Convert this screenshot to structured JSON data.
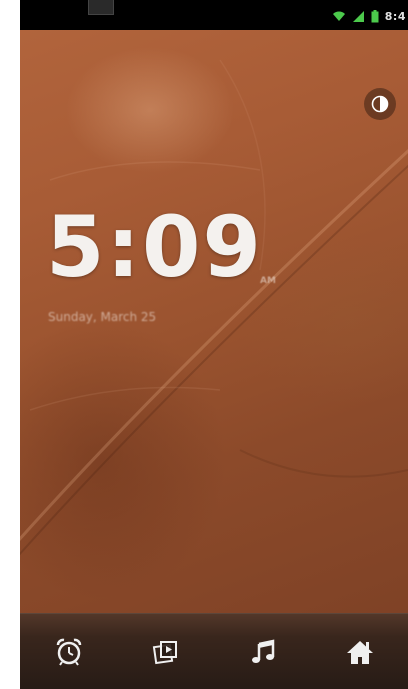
{
  "status_bar": {
    "time": "8:4",
    "icons": [
      "notification-app-icon",
      "wifi-icon",
      "signal-icon",
      "battery-icon"
    ]
  },
  "lock_screen": {
    "time": "5:09",
    "ampm": "AM",
    "date": "Sunday, March 25",
    "brightness_icon": "brightness-icon"
  },
  "dock": {
    "items": [
      {
        "name": "alarm",
        "icon": "alarm-clock-icon"
      },
      {
        "name": "gallery",
        "icon": "gallery-icon"
      },
      {
        "name": "music",
        "icon": "music-note-icon"
      },
      {
        "name": "home",
        "icon": "home-icon"
      }
    ]
  },
  "colors": {
    "wallpaper": "#a85c36",
    "clock_text": "#f4f1ee",
    "status_green": "#4cc94c",
    "dock_icon": "#f0f0f0"
  }
}
